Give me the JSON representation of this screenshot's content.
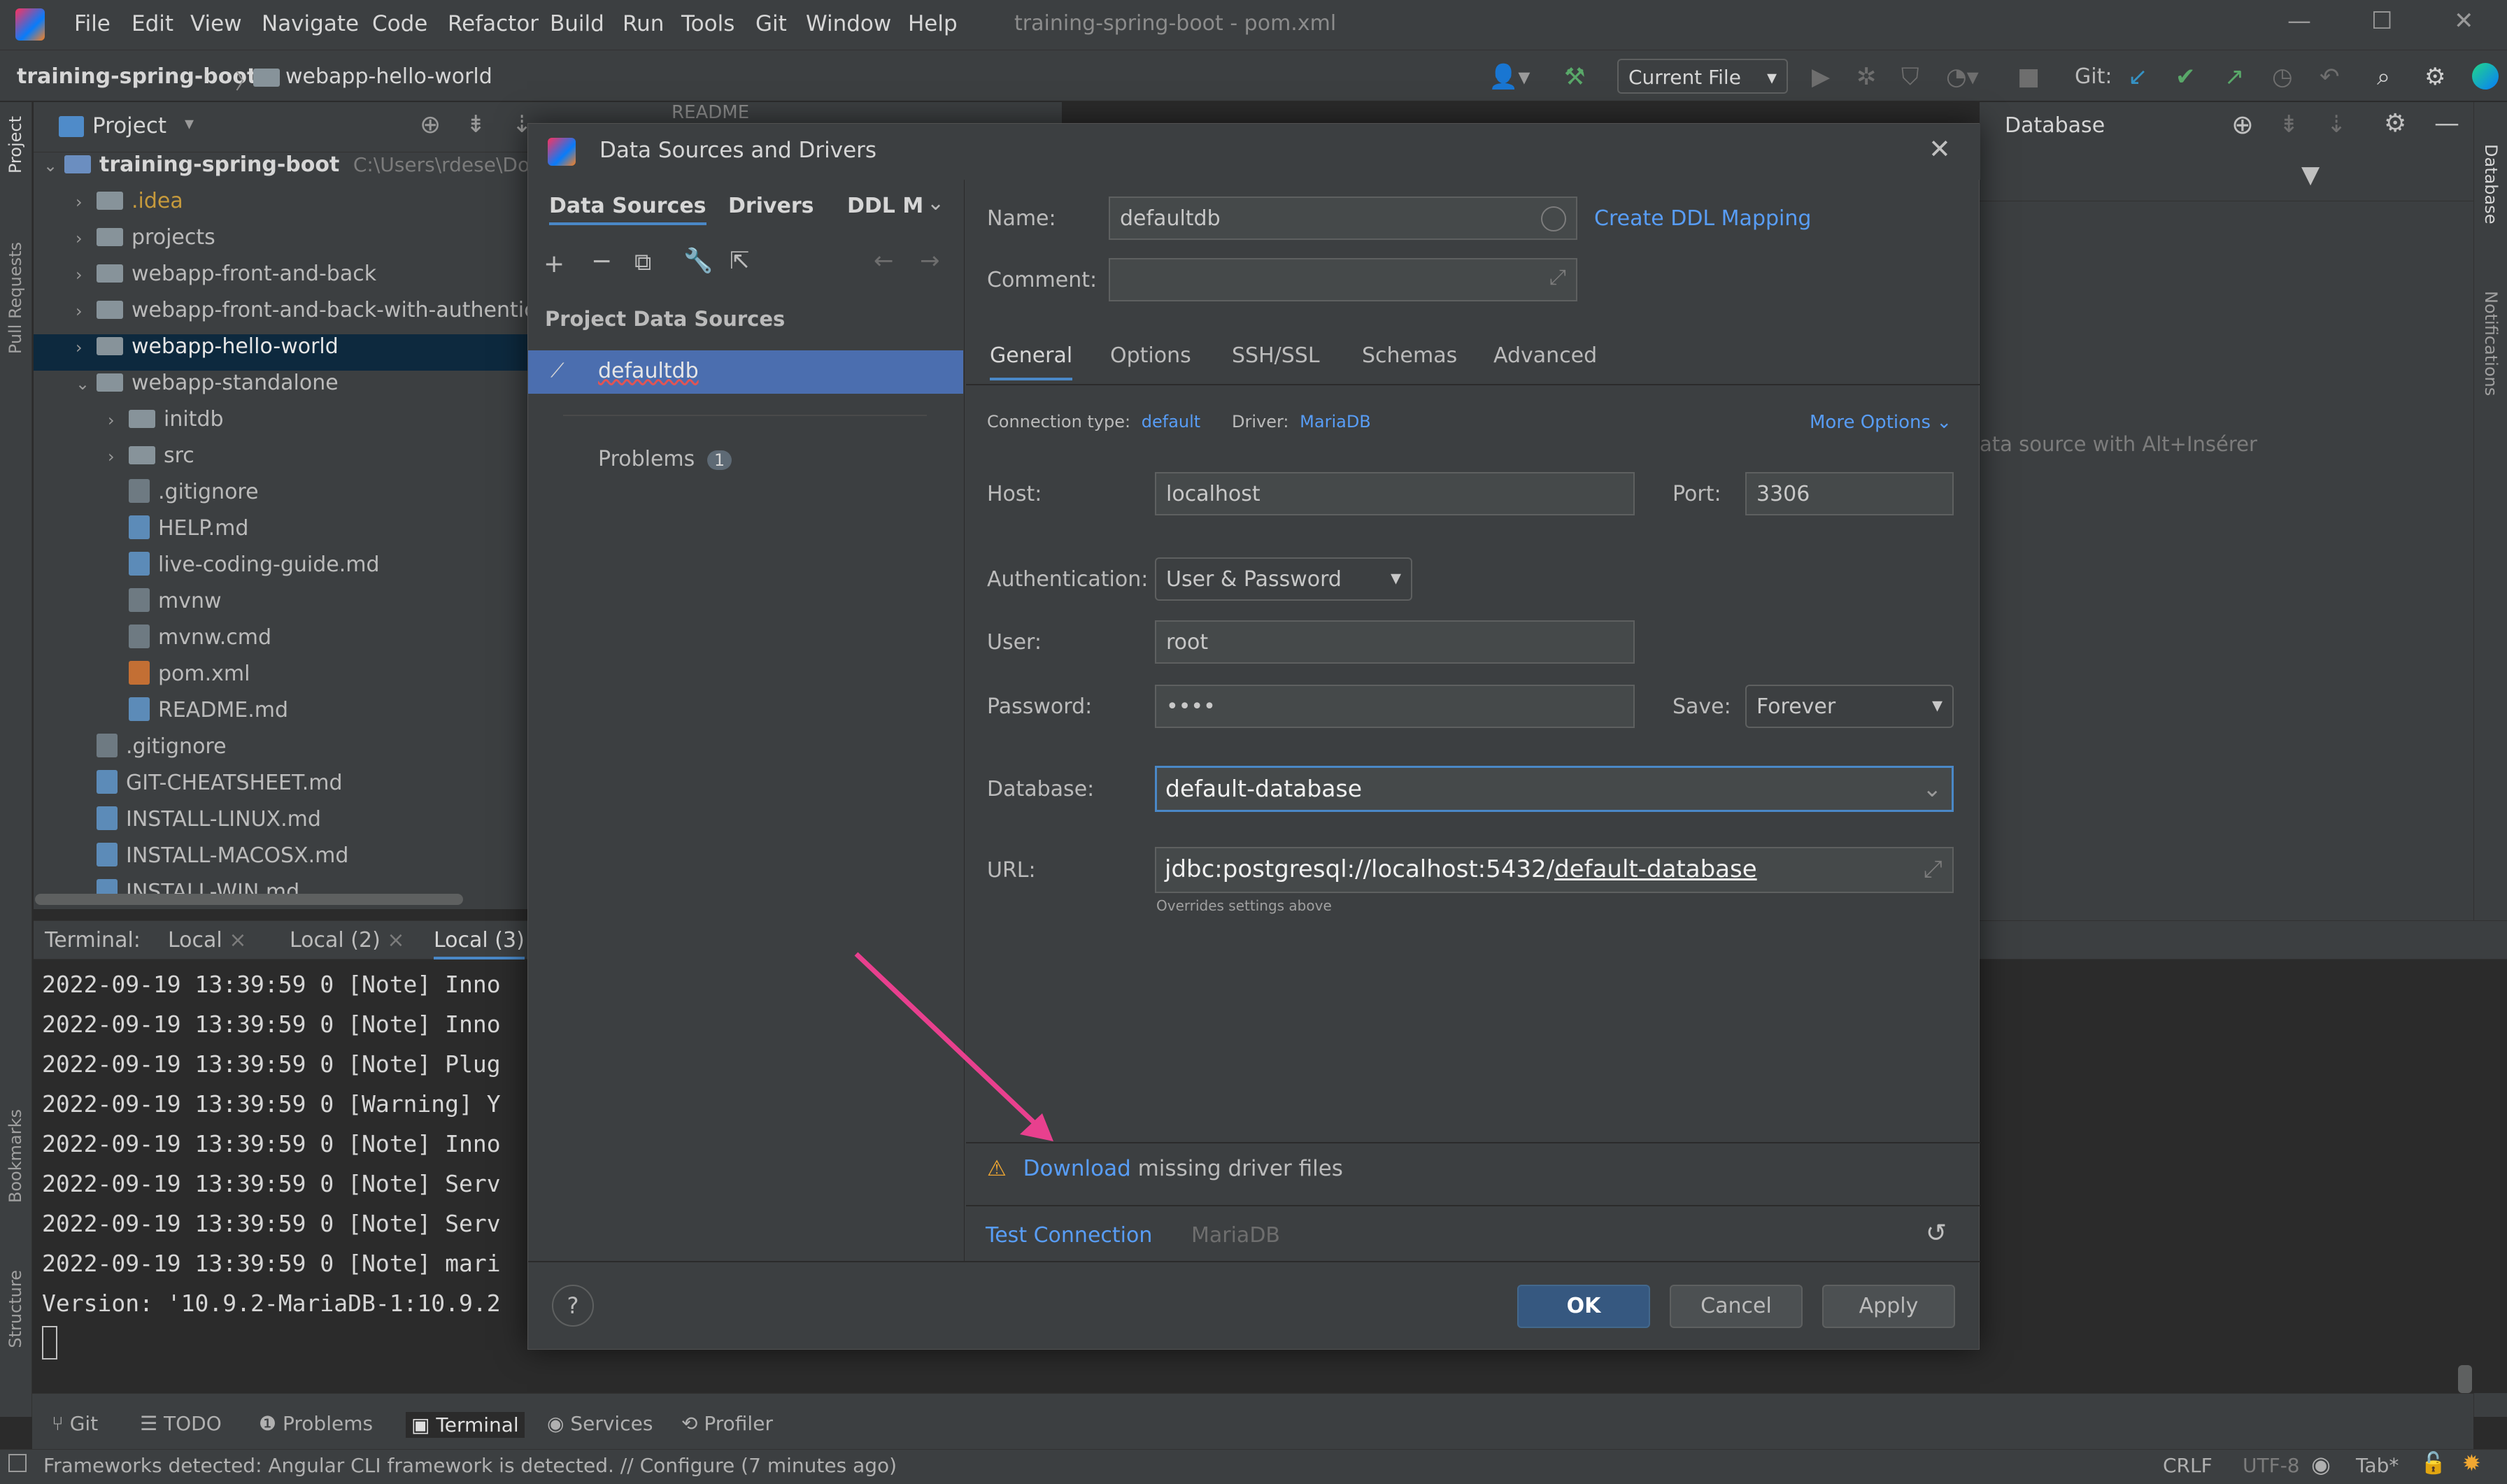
{
  "window": {
    "title": "training-spring-boot - pom.xml",
    "menu": [
      "File",
      "Edit",
      "View",
      "Navigate",
      "Code",
      "Refactor",
      "Build",
      "Run",
      "Tools",
      "Git",
      "Window",
      "Help"
    ]
  },
  "navbar": {
    "project": "training-spring-boot",
    "module": "webapp-hello-world",
    "run_config": "Current File",
    "git_label": "Git:"
  },
  "project_panel": {
    "title": "Project",
    "root": "training-spring-boot",
    "root_path": "C:\\Users\\rdese\\Docu",
    "items": [
      {
        "label": ".idea",
        "type": "folder",
        "expandable": true
      },
      {
        "label": "projects",
        "type": "folder",
        "expandable": true
      },
      {
        "label": "webapp-front-and-back",
        "type": "folder",
        "expandable": true
      },
      {
        "label": "webapp-front-and-back-with-authentic",
        "type": "folder",
        "expandable": true
      },
      {
        "label": "webapp-hello-world",
        "type": "folder",
        "expandable": true,
        "selected": true
      },
      {
        "label": "webapp-standalone",
        "type": "folder",
        "expanded": true
      },
      {
        "label": "initdb",
        "type": "folder",
        "expandable": true
      },
      {
        "label": "src",
        "type": "folder",
        "expandable": true
      },
      {
        "label": ".gitignore",
        "type": "file"
      },
      {
        "label": "HELP.md",
        "type": "md"
      },
      {
        "label": "live-coding-guide.md",
        "type": "md"
      },
      {
        "label": "mvnw",
        "type": "file"
      },
      {
        "label": "mvnw.cmd",
        "type": "file"
      },
      {
        "label": "pom.xml",
        "type": "xml"
      },
      {
        "label": "README.md",
        "type": "md"
      },
      {
        "label": ".gitignore",
        "type": "file"
      },
      {
        "label": "GIT-CHEATSHEET.md",
        "type": "md"
      },
      {
        "label": "INSTALL-LINUX.md",
        "type": "md"
      },
      {
        "label": "INSTALL-MACOSX.md",
        "type": "md"
      },
      {
        "label": "INSTALL-WIN.md",
        "type": "md"
      }
    ]
  },
  "editor_tab": "README",
  "database_panel": {
    "title": "Database",
    "hint": "ata source with Alt+Insérer"
  },
  "terminal": {
    "label": "Terminal:",
    "tabs": [
      "Local",
      "Local (2)",
      "Local (3)"
    ],
    "lines": [
      "2022-09-19 13:39:59 0 [Note] Inno",
      "2022-09-19 13:39:59 0 [Note] Inno",
      "2022-09-19 13:39:59 0 [Note] Plug",
      "2022-09-19 13:39:59 0 [Warning] Y",
      "2022-09-19 13:39:59 0 [Note] Inno",
      "2022-09-19 13:39:59 0 [Note] Serv",
      "2022-09-19 13:39:59 0 [Note] Serv",
      "2022-09-19 13:39:59 0 [Note] mari",
      "Version: '10.9.2-MariaDB-1:10.9.2"
    ]
  },
  "bottom_tools": [
    "Git",
    "TODO",
    "Problems",
    "Terminal",
    "Services",
    "Profiler"
  ],
  "statusbar": {
    "message": "Frameworks detected: Angular CLI framework is detected. // Configure (7 minutes ago)",
    "line_sep": "CRLF",
    "encoding": "UTF-8",
    "indent": "Tab*"
  },
  "left_stripe": {
    "project": "Project",
    "pull_requests": "Pull Requests",
    "bookmarks": "Bookmarks",
    "structure": "Structure"
  },
  "right_stripe": {
    "database": "Database",
    "notifications": "Notifications"
  },
  "dialog": {
    "title": "Data Sources and Drivers",
    "left_tabs": [
      "Data Sources",
      "Drivers",
      "DDL M"
    ],
    "section": "Project Data Sources",
    "datasource": "defaultdb",
    "problems_label": "Problems",
    "problems_count": "1",
    "name_label": "Name:",
    "name_value": "defaultdb",
    "create_ddl": "Create DDL Mapping",
    "comment_label": "Comment:",
    "comment_value": "",
    "tabs": [
      "General",
      "Options",
      "SSH/SSL",
      "Schemas",
      "Advanced"
    ],
    "active_tab": "General",
    "conn_type_label": "Connection type:",
    "conn_type_value": "default",
    "driver_label": "Driver:",
    "driver_value": "MariaDB",
    "more_options": "More Options",
    "host_label": "Host:",
    "host_value": "localhost",
    "port_label": "Port:",
    "port_value": "3306",
    "auth_label": "Authentication:",
    "auth_value": "User & Password",
    "user_label": "User:",
    "user_value": "root",
    "password_label": "Password:",
    "password_value": "••••",
    "save_label": "Save:",
    "save_value": "Forever",
    "database_label": "Database:",
    "database_value": "default-database",
    "url_label": "URL:",
    "url_prefix": "jdbc:postgresql://localhost:5432/",
    "url_db": "default-database",
    "url_hint": "Overrides settings above",
    "warning_link": "Download",
    "warning_text": "missing driver files",
    "test_connection": "Test Connection",
    "test_driver": "MariaDB",
    "help": "?",
    "ok": "OK",
    "cancel": "Cancel",
    "apply": "Apply"
  },
  "colors": {
    "accent": "#589df6",
    "selection": "#4b6eaf",
    "annotation_arrow": "#e8408e",
    "warning": "#f0a732"
  }
}
